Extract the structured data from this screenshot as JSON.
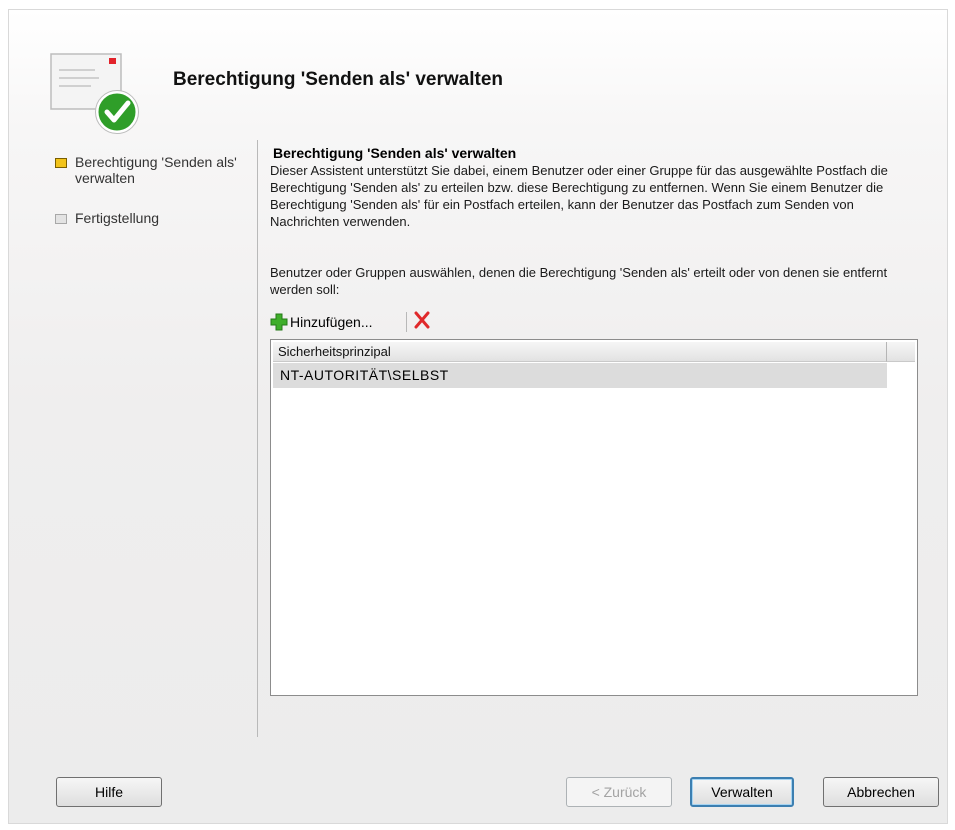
{
  "header": {
    "title": "Berechtigung 'Senden als' verwalten"
  },
  "nav": {
    "items": [
      {
        "label": "Berechtigung 'Senden als' verwalten",
        "state": "active"
      },
      {
        "label": "Fertigstellung",
        "state": "inactive"
      }
    ]
  },
  "content": {
    "title": "Berechtigung 'Senden als' verwalten",
    "description": "Dieser Assistent unterstützt Sie dabei, einem Benutzer oder einer Gruppe für das ausgewählte Postfach die Berechtigung 'Senden als' zu erteilen bzw. diese Berechtigung zu entfernen. Wenn Sie einem Benutzer die Berechtigung 'Senden als' für ein Postfach erteilen, kann der Benutzer das Postfach zum Senden von Nachrichten verwenden.",
    "instruction": "Benutzer oder Gruppen auswählen, denen die Berechtigung 'Senden als' erteilt oder von denen sie entfernt werden soll:"
  },
  "toolbar": {
    "add_label": "Hinzufügen...",
    "add_icon": "plus-icon",
    "remove_icon": "delete-x-icon"
  },
  "list": {
    "column_header": "Sicherheitsprinzipal",
    "rows": [
      "NT-AUTORITÄT\\SELBST"
    ]
  },
  "buttons": {
    "help": "Hilfe",
    "back": "< Zurück",
    "manage": "Verwalten",
    "cancel": "Abbrechen"
  },
  "colors": {
    "active_bullet": "#f2c31a",
    "remove_icon": "#e0292b",
    "plus_icon": "#3fae2a"
  }
}
